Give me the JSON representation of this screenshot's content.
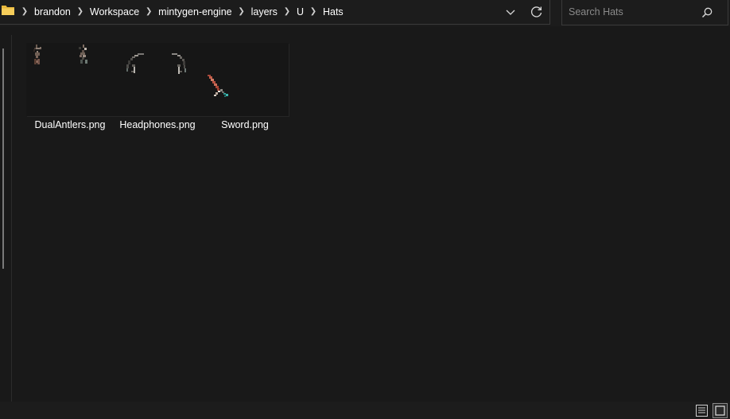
{
  "breadcrumb": {
    "icon": "folder-icon",
    "items": [
      "brandon",
      "Workspace",
      "mintygen-engine",
      "layers",
      "U",
      "Hats"
    ]
  },
  "toolbar": {
    "dropdown_icon": "chevron-down-icon",
    "refresh_icon": "refresh-icon"
  },
  "search": {
    "placeholder": "Search Hats",
    "value": "",
    "icon": "search-icon"
  },
  "files": [
    {
      "name": "DualAntlers.png",
      "thumbnail": "dual-antlers-thumbnail"
    },
    {
      "name": "Headphones.png",
      "thumbnail": "headphones-thumbnail"
    },
    {
      "name": "Sword.png",
      "thumbnail": "sword-thumbnail"
    }
  ],
  "statusbar": {
    "view_buttons": [
      "details-view-icon",
      "large-icons-view-icon"
    ]
  },
  "colors": {
    "background": "#191919",
    "chrome": "#1c1c1c",
    "border": "#3a3a3a",
    "folder": "#f0c44c",
    "text": "#ffffff",
    "placeholder": "#8a8a8a"
  }
}
